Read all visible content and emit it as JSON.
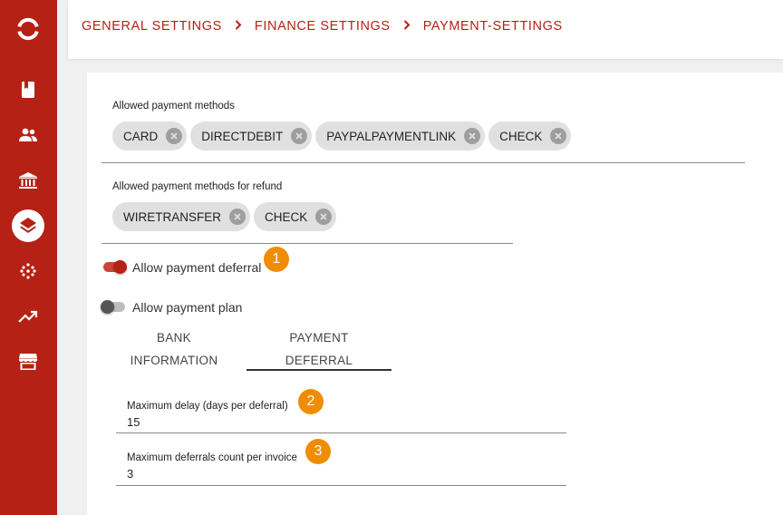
{
  "sidebar": {
    "items": [
      {
        "icon": "app-logo-icon"
      },
      {
        "icon": "book-icon"
      },
      {
        "icon": "users-icon"
      },
      {
        "icon": "bank-icon"
      },
      {
        "icon": "layers-icon",
        "active": true
      },
      {
        "icon": "dots-grid-icon"
      },
      {
        "icon": "trending-up-icon"
      },
      {
        "icon": "store-icon"
      }
    ],
    "colors": {
      "background": "#b52114",
      "icon": "#ffffff",
      "active_icon": "#b52114"
    }
  },
  "breadcrumb": {
    "items": [
      "GENERAL SETTINGS",
      "FINANCE SETTINGS",
      "PAYMENT-SETTINGS"
    ],
    "separator": "›",
    "color": "#b52114"
  },
  "payment_methods": {
    "label": "Allowed payment methods",
    "chips": [
      "CARD",
      "DIRECTDEBIT",
      "PAYPALPAYMENTLINK",
      "CHECK"
    ]
  },
  "refund_methods": {
    "label": "Allowed payment methods for refund",
    "chips": [
      "WIRETRANSFER",
      "CHECK"
    ]
  },
  "toggles": {
    "deferral": {
      "label": "Allow payment deferral",
      "on": true
    },
    "plan": {
      "label": "Allow payment plan",
      "on": false
    }
  },
  "tabs": [
    {
      "line1": "BANK",
      "line2": "INFORMATION",
      "active": false
    },
    {
      "line1": "PAYMENT",
      "line2": "DEFERRAL",
      "active": true
    }
  ],
  "fields": {
    "max_delay": {
      "label": "Maximum delay (days per deferral)",
      "value": "15"
    },
    "max_count": {
      "label": "Maximum deferrals count per invoice",
      "value": "3"
    }
  },
  "badges": [
    "1",
    "2",
    "3"
  ],
  "accent_color": "#f08c00"
}
